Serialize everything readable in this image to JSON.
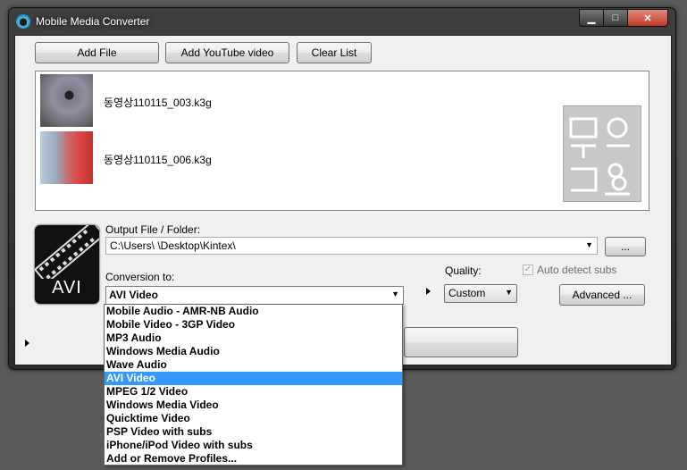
{
  "window": {
    "title": "Mobile Media Converter",
    "controls": {
      "minimize": "▁",
      "maximize": "□",
      "close": "✕"
    }
  },
  "toolbar": {
    "add_file": "Add File",
    "add_youtube": "Add YouTube video",
    "clear_list": "Clear List"
  },
  "files": [
    {
      "name": "동영상110115_003.k3g"
    },
    {
      "name": "동영상110115_006.k3g"
    }
  ],
  "output": {
    "label": "Output File / Folder:",
    "path": "C:\\Users\\       \\Desktop\\Kintex\\",
    "browse_label": "..."
  },
  "format_logo": {
    "text": "AVI"
  },
  "conversion": {
    "label": "Conversion to:",
    "selected": "AVI Video",
    "options": [
      "Mobile Audio - AMR-NB Audio",
      "Mobile Video - 3GP Video",
      "MP3 Audio",
      "Windows Media Audio",
      "Wave Audio",
      "AVI Video",
      "MPEG 1/2 Video",
      "Windows Media Video",
      "Quicktime Video",
      "PSP Video with subs",
      "iPhone/iPod Video with subs",
      "Add or Remove Profiles..."
    ],
    "selected_index": 5
  },
  "quality": {
    "label": "Quality:",
    "value": "Custom"
  },
  "auto_detect": {
    "label": "Auto detect subs",
    "checked": true
  },
  "advanced": {
    "label": "Advanced ..."
  },
  "colors": {
    "selection": "#3399ff",
    "window_frame": "#2f2f2f"
  }
}
